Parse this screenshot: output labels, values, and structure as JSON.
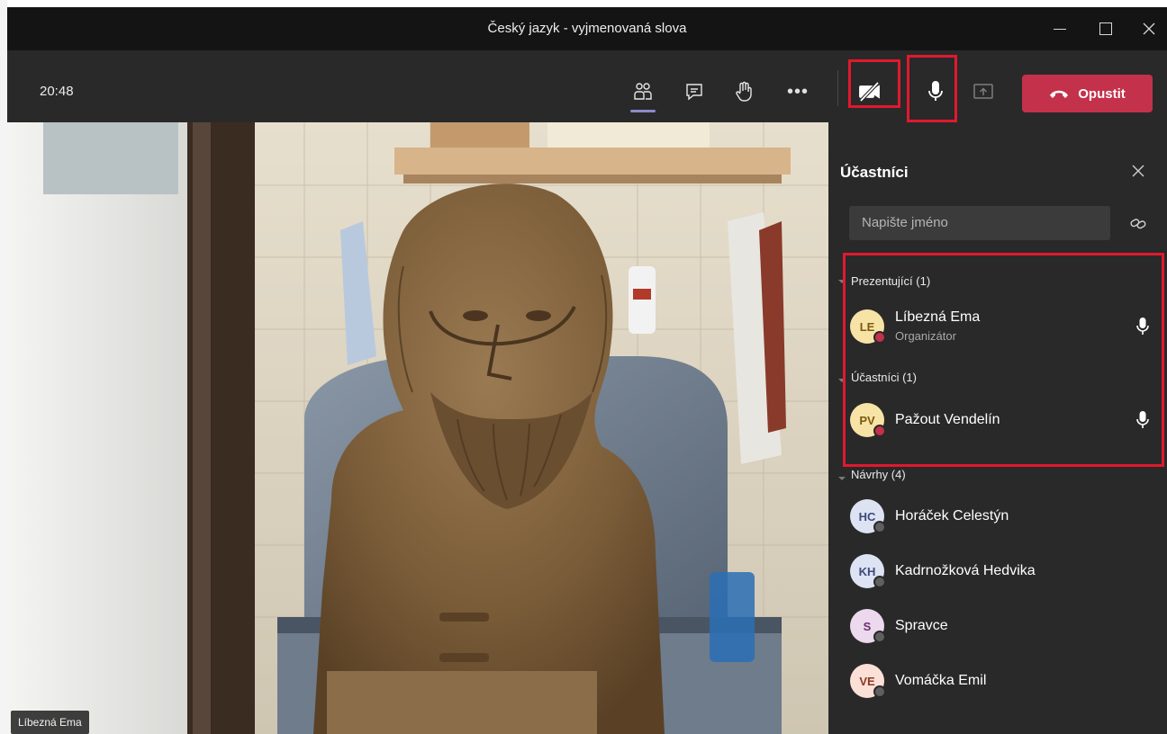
{
  "window": {
    "title": "Český jazyk - vyjmenovaná slova",
    "controls": [
      "minimize-icon",
      "maximize-icon",
      "close-icon"
    ]
  },
  "toolbar": {
    "clock": "20:48",
    "icons": [
      "people-icon",
      "chat-icon",
      "raise-hand-icon",
      "more-icon",
      "camera-off-icon",
      "microphone-icon",
      "share-screen-icon"
    ],
    "more_glyph": "•••",
    "leave_label": "Opustit",
    "leave_color": "#c4314b",
    "highlight_color": "#e0192e"
  },
  "video": {
    "participant_label": "Líbezná Ema"
  },
  "panel": {
    "title": "Účastníci",
    "search_placeholder": "Napište jméno",
    "groups": [
      {
        "label": "Prezentující (1)",
        "members": [
          {
            "initials": "LE",
            "name": "Líbezná Ema",
            "role": "Organizátor",
            "avatar_bg": "#f8e3a6",
            "avatar_fg": "#7a5a10",
            "status": "busy",
            "mic": true
          }
        ]
      },
      {
        "label": "Účastníci (1)",
        "members": [
          {
            "initials": "PV",
            "name": "Pažout Vendelín",
            "role": "",
            "avatar_bg": "#f8e3a6",
            "avatar_fg": "#7a5a10",
            "status": "busy",
            "mic": true
          }
        ]
      },
      {
        "label": "Návrhy (4)",
        "members": [
          {
            "initials": "HC",
            "name": "Horáček Celestýn",
            "avatar_bg": "#dde3f3",
            "avatar_fg": "#3d4a7a",
            "status": "offline"
          },
          {
            "initials": "KH",
            "name": "Kadrnožková Hedvika",
            "avatar_bg": "#dde3f3",
            "avatar_fg": "#3d4a7a",
            "status": "offline"
          },
          {
            "initials": "S",
            "name": "Spravce",
            "avatar_bg": "#ecd9ee",
            "avatar_fg": "#6a2f70",
            "status": "offline"
          },
          {
            "initials": "VE",
            "name": "Vomáčka Emil",
            "avatar_bg": "#fbe0d8",
            "avatar_fg": "#8a3a20",
            "status": "offline"
          }
        ]
      }
    ]
  }
}
